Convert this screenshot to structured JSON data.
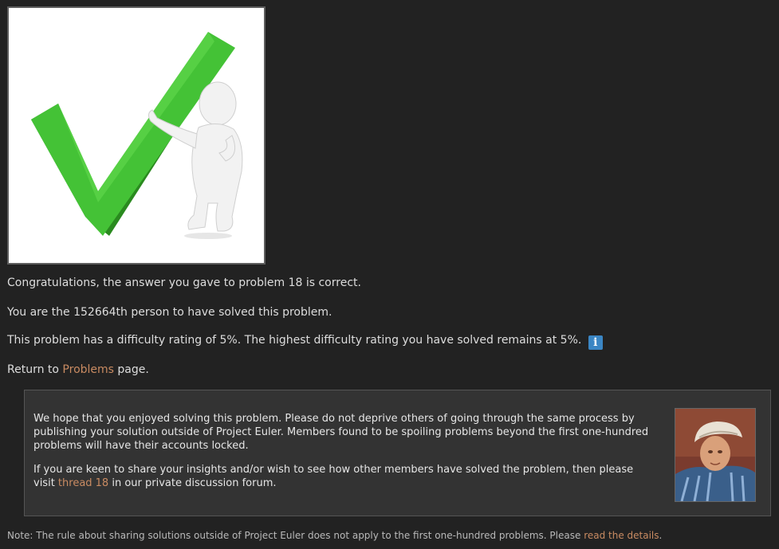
{
  "images": {
    "hero_icon": "checkmark-with-figure-icon",
    "portrait_icon": "euler-portrait-icon"
  },
  "result": {
    "congrats": "Congratulations, the answer you gave to problem 18 is correct.",
    "solver_rank": "You are the 152664th person to have solved this problem.",
    "difficulty": "This problem has a difficulty rating of 5%. The highest difficulty rating you have solved remains at 5%.",
    "info_icon": "i",
    "return_prefix": "Return to ",
    "problems_link": "Problems",
    "return_suffix": " page."
  },
  "notice": {
    "paragraph1": "We hope that you enjoyed solving this problem. Please do not deprive others of going through the same process by publishing your solution outside of Project Euler. Members found to be spoiling problems beyond the first one-hundred problems will have their accounts locked.",
    "paragraph2_prefix": "If you are keen to share your insights and/or wish to see how other members have solved the problem, then please visit ",
    "thread_link": "thread 18",
    "paragraph2_suffix": " in our private discussion forum."
  },
  "footer": {
    "note_prefix": "Note: The rule about sharing solutions outside of Project Euler does not apply to the first one-hundred problems. Please ",
    "details_link": "read the details",
    "note_suffix": "."
  },
  "colors": {
    "background": "#222222",
    "link": "#c98b62",
    "info_button": "#3b86c4",
    "check_green": "#3cb52e",
    "box_background": "#333333"
  }
}
